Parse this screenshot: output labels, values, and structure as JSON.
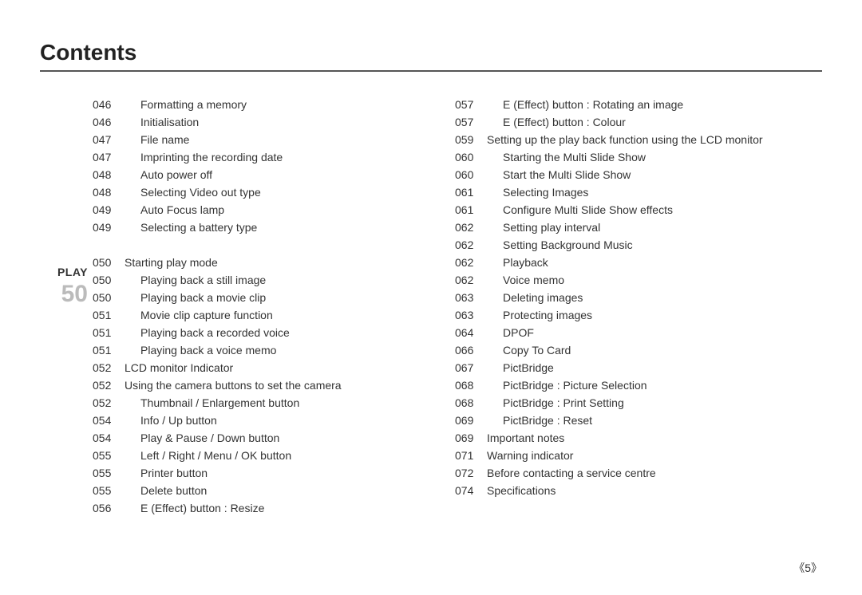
{
  "title": "Contents",
  "section": {
    "label": "PLAY",
    "number": "50"
  },
  "page_number": "5",
  "columns": {
    "left_pre": [
      {
        "pg": "046",
        "txt": "Formatting a memory",
        "indent": 1
      },
      {
        "pg": "046",
        "txt": "Initialisation",
        "indent": 1
      },
      {
        "pg": "047",
        "txt": "File name",
        "indent": 1
      },
      {
        "pg": "047",
        "txt": "Imprinting the recording date",
        "indent": 1
      },
      {
        "pg": "048",
        "txt": "Auto power off",
        "indent": 1
      },
      {
        "pg": "048",
        "txt": "Selecting Video out type",
        "indent": 1
      },
      {
        "pg": "049",
        "txt": "Auto Focus lamp",
        "indent": 1
      },
      {
        "pg": "049",
        "txt": "Selecting a battery type",
        "indent": 1
      }
    ],
    "left_play": [
      {
        "pg": "050",
        "txt": "Starting play mode",
        "indent": 0
      },
      {
        "pg": "050",
        "txt": "Playing back a still image",
        "indent": 1
      },
      {
        "pg": "050",
        "txt": "Playing back a movie clip",
        "indent": 1
      },
      {
        "pg": "051",
        "txt": "Movie clip capture function",
        "indent": 1
      },
      {
        "pg": "051",
        "txt": "Playing back a recorded voice",
        "indent": 1
      },
      {
        "pg": "051",
        "txt": "Playing back a voice memo",
        "indent": 1
      },
      {
        "pg": "052",
        "txt": "LCD monitor Indicator",
        "indent": 0
      },
      {
        "pg": "052",
        "txt": "Using the camera buttons to set the camera",
        "indent": 0
      },
      {
        "pg": "052",
        "txt": "Thumbnail / Enlargement button",
        "indent": 1
      },
      {
        "pg": "054",
        "txt": "Info / Up button",
        "indent": 1
      },
      {
        "pg": "054",
        "txt": "Play & Pause / Down button",
        "indent": 1
      },
      {
        "pg": "055",
        "txt": "Left / Right / Menu / OK button",
        "indent": 1
      },
      {
        "pg": "055",
        "txt": "Printer button",
        "indent": 1
      },
      {
        "pg": "055",
        "txt": "Delete button",
        "indent": 1
      },
      {
        "pg": "056",
        "txt": "E (Effect) button : Resize",
        "indent": 1
      }
    ],
    "right": [
      {
        "pg": "057",
        "txt": "E (Effect) button : Rotating an image",
        "indent": 1
      },
      {
        "pg": "057",
        "txt": "E (Effect) button : Colour",
        "indent": 1
      },
      {
        "pg": "059",
        "txt": "Setting up the play back function using the LCD monitor",
        "indent": 0
      },
      {
        "pg": "060",
        "txt": "Starting the Multi Slide Show",
        "indent": 1
      },
      {
        "pg": "060",
        "txt": "Start the Multi Slide Show",
        "indent": 1
      },
      {
        "pg": "061",
        "txt": "Selecting Images",
        "indent": 1
      },
      {
        "pg": "061",
        "txt": "Configure Multi Slide Show effects",
        "indent": 1
      },
      {
        "pg": "062",
        "txt": "Setting play interval",
        "indent": 1
      },
      {
        "pg": "062",
        "txt": "Setting Background Music",
        "indent": 1
      },
      {
        "pg": "062",
        "txt": "Playback",
        "indent": 1
      },
      {
        "pg": "062",
        "txt": "Voice memo",
        "indent": 1
      },
      {
        "pg": "063",
        "txt": "Deleting images",
        "indent": 1
      },
      {
        "pg": "063",
        "txt": "Protecting images",
        "indent": 1
      },
      {
        "pg": "064",
        "txt": "DPOF",
        "indent": 1
      },
      {
        "pg": "066",
        "txt": "Copy To Card",
        "indent": 1
      },
      {
        "pg": "067",
        "txt": "PictBridge",
        "indent": 1
      },
      {
        "pg": "068",
        "txt": "PictBridge : Picture Selection",
        "indent": 1
      },
      {
        "pg": "068",
        "txt": "PictBridge : Print Setting",
        "indent": 1
      },
      {
        "pg": "069",
        "txt": "PictBridge : Reset",
        "indent": 1
      },
      {
        "pg": "069",
        "txt": "Important notes",
        "indent": 0
      },
      {
        "pg": "071",
        "txt": "Warning indicator",
        "indent": 0
      },
      {
        "pg": "072",
        "txt": "Before contacting a service centre",
        "indent": 0
      },
      {
        "pg": "074",
        "txt": "Specifications",
        "indent": 0
      }
    ]
  }
}
